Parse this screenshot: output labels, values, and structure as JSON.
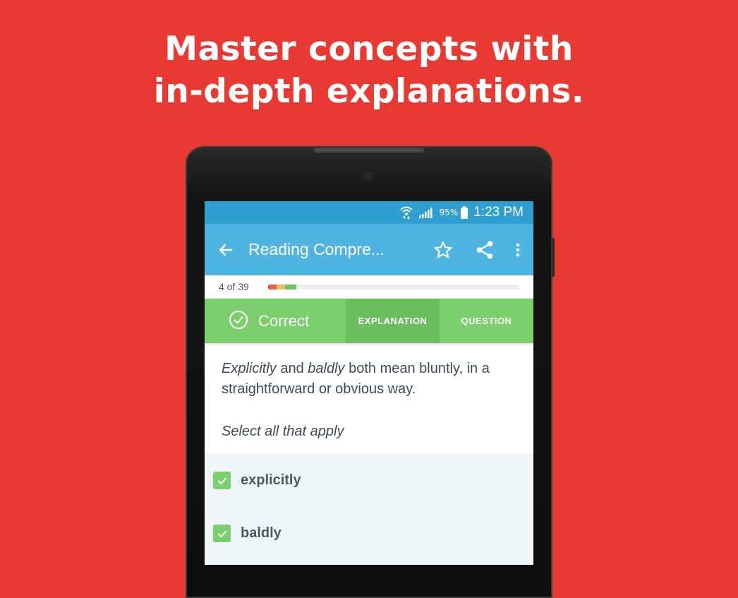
{
  "headline": {
    "line1": "Master concepts with",
    "line2": "in-depth explanations."
  },
  "status_bar": {
    "battery": "95%",
    "time": "1:23 PM",
    "icons": [
      "wifi-icon",
      "signal-icon",
      "battery-icon"
    ]
  },
  "app_bar": {
    "title": "Reading Compre...",
    "icons": [
      "back-arrow-icon",
      "star-icon",
      "share-icon",
      "more-vert-icon"
    ]
  },
  "progress": {
    "label": "4 of 39",
    "current": 4,
    "total": 39,
    "segments": [
      {
        "status": "incorrect",
        "color": "#f05a50"
      },
      {
        "status": "partial",
        "color": "#f2c05a"
      },
      {
        "status": "correct",
        "color": "#6cc45c"
      },
      {
        "status": "correct",
        "color": "#6cc45c"
      }
    ]
  },
  "result": {
    "status": "Correct",
    "tabs": [
      {
        "label": "EXPLANATION",
        "active": true
      },
      {
        "label": "QUESTION",
        "active": false
      }
    ]
  },
  "question": {
    "word1": "Explicitly",
    "mid": " and ",
    "word2": "baldly",
    "rest": " both mean bluntly, in a straightforward or obvious way.",
    "instruction": "Select all that apply"
  },
  "answers": [
    {
      "label": "explicitly",
      "checked": true
    },
    {
      "label": "baldly",
      "checked": true
    }
  ],
  "colors": {
    "background": "#e83a33",
    "status_bar": "#2e9fd0",
    "app_bar": "#4fb5e0",
    "correct_green": "#7bd06d",
    "active_tab": "#6cbf5f",
    "answer_bg": "#eef6fa"
  }
}
